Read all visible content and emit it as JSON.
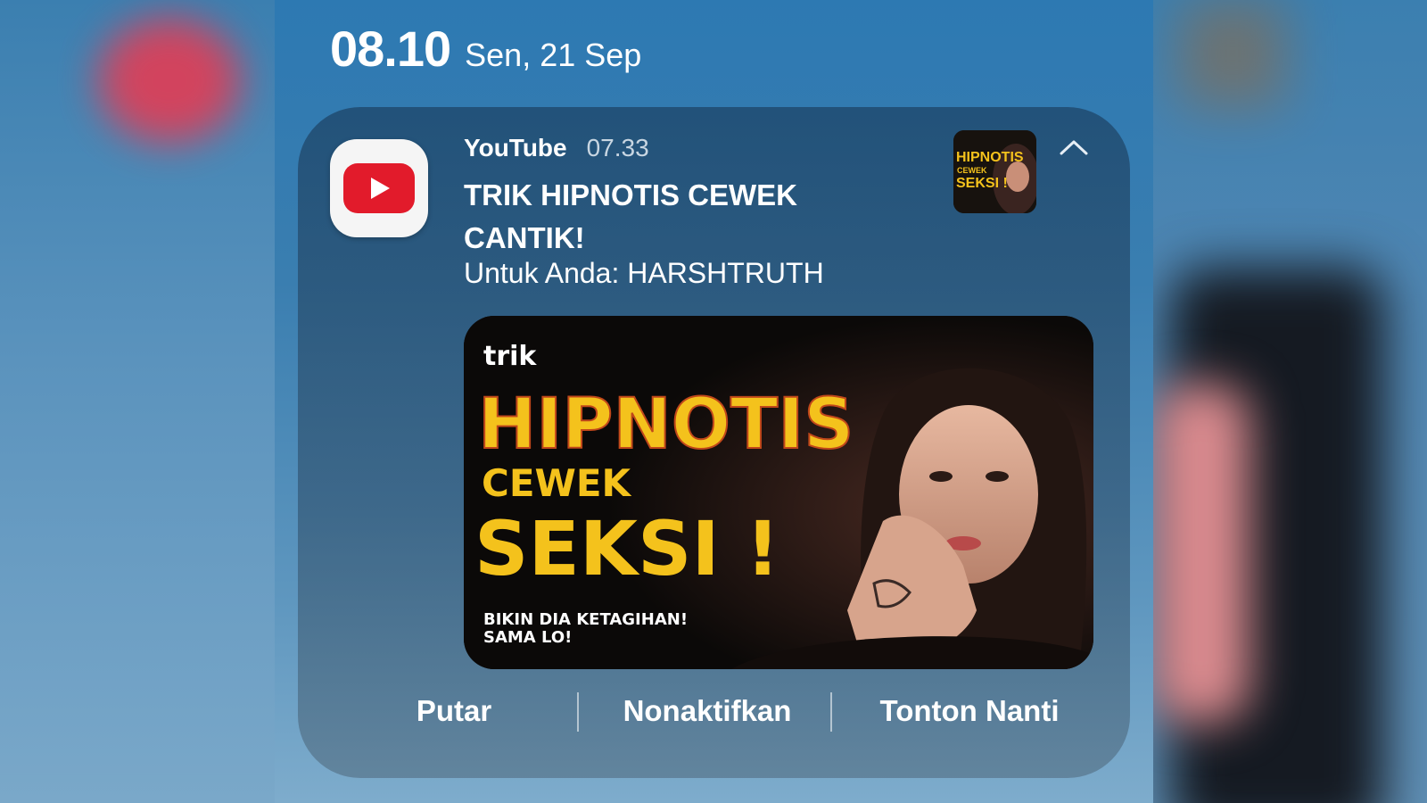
{
  "status_bar": {
    "time": "08.10",
    "date": "Sen, 21 Sep"
  },
  "notification": {
    "app_name": "YouTube",
    "received_time": "07.33",
    "title": "TRIK HIPNOTIS CEWEK CANTIK!",
    "subtitle": "Untuk Anda: HARSHTRUTH",
    "app_icon": "youtube-icon",
    "collapse_icon": "chevron-up-icon",
    "thumbnail": {
      "small_line1": "HIPNOTIS",
      "small_line2": "CEWEK",
      "small_line3": "SEKSI !",
      "top": "trik",
      "headline": "HIPNOTIS",
      "line2": "CEWEK",
      "line3": "SEKSI !",
      "caption1": "BIKIN DIA KETAGIHAN!",
      "caption2": "SAMA LO!"
    },
    "actions": {
      "play": "Putar",
      "disable": "Nonaktifkan",
      "watch_later": "Tonton Nanti"
    }
  },
  "colors": {
    "brand_red": "#e21b2b",
    "headline_yellow": "#f4c21c"
  }
}
